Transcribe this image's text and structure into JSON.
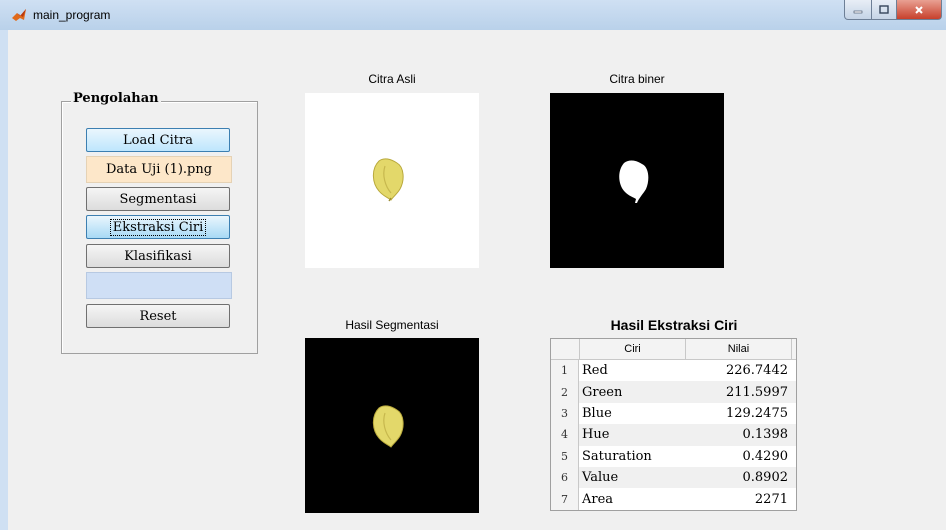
{
  "window": {
    "title": "main_program",
    "minimize_label": "–",
    "maximize_label": "□",
    "close_label": "X"
  },
  "panel": {
    "title": "Pengolahan",
    "load_button": "Load Citra",
    "filename": "Data Uji (1).png",
    "segmentasi_button": "Segmentasi",
    "ekstraksi_button": "Ekstraksi Ciri",
    "klasifikasi_button": "Klasifikasi",
    "result": "",
    "reset_button": "Reset"
  },
  "images": {
    "asli_caption": "Citra Asli",
    "biner_caption": "Citra biner",
    "segmentasi_caption": "Hasil Segmentasi"
  },
  "table": {
    "title": "Hasil Ekstraksi Ciri",
    "columns": [
      "Ciri",
      "Nilai"
    ],
    "rows": [
      {
        "no": "1",
        "ciri": "Red",
        "nilai": "226.7442"
      },
      {
        "no": "2",
        "ciri": "Green",
        "nilai": "211.5997"
      },
      {
        "no": "3",
        "ciri": "Blue",
        "nilai": "129.2475"
      },
      {
        "no": "4",
        "ciri": "Hue",
        "nilai": "0.1398"
      },
      {
        "no": "5",
        "ciri": "Saturation",
        "nilai": "0.4290"
      },
      {
        "no": "6",
        "ciri": "Value",
        "nilai": "0.8902"
      },
      {
        "no": "7",
        "ciri": "Area",
        "nilai": "2271"
      }
    ]
  },
  "colors": {
    "accent_blue": "#bee6fd",
    "filename_bg": "#fde7c9",
    "result_bg": "#cfdff5",
    "leaf": "#e3d86a"
  }
}
